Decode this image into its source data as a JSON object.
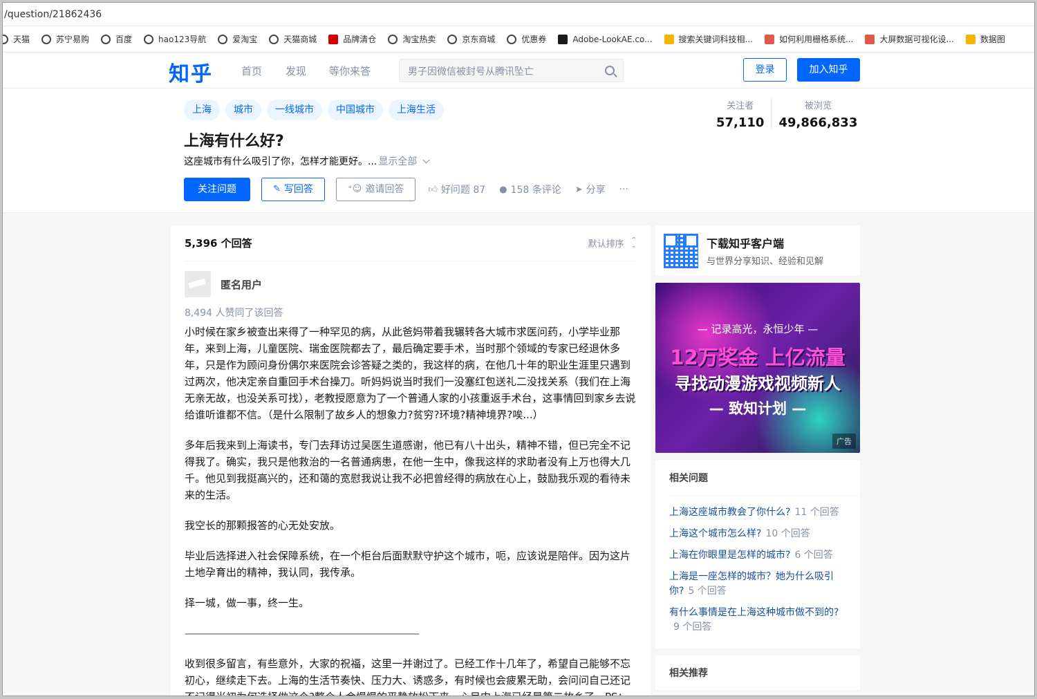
{
  "browser": {
    "url": "/question/21862436",
    "bookmarks": [
      {
        "label": "天猫",
        "icon": "globe-icon",
        "color": "#444444"
      },
      {
        "label": "苏宁易购",
        "icon": "globe-icon",
        "color": "#444444"
      },
      {
        "label": "百度",
        "icon": "globe-icon",
        "color": "#444444"
      },
      {
        "label": "hao123导航",
        "icon": "globe-icon",
        "color": "#444444"
      },
      {
        "label": "爱淘宝",
        "icon": "globe-icon",
        "color": "#444444"
      },
      {
        "label": "天猫商城",
        "icon": "globe-icon",
        "color": "#444444"
      },
      {
        "label": "品牌清仓",
        "icon": "tmall-icon",
        "color": "#d00000"
      },
      {
        "label": "淘宝热卖",
        "icon": "globe-icon",
        "color": "#444444"
      },
      {
        "label": "京东商城",
        "icon": "globe-icon",
        "color": "#444444"
      },
      {
        "label": "优惠券",
        "icon": "globe-icon",
        "color": "#444444"
      },
      {
        "label": "Adobe-LookAE.co...",
        "icon": "dz-icon",
        "color": "#1a1a1a"
      },
      {
        "label": "搜索关键词科技相...",
        "icon": "thumb-icon",
        "color": "#f5b400"
      },
      {
        "label": "如何利用栅格系统...",
        "icon": "jian-icon",
        "color": "#e05a4b"
      },
      {
        "label": "大屏数据可视化设...",
        "icon": "jian-icon",
        "color": "#e05a4b"
      },
      {
        "label": "数据图",
        "icon": "chart-icon",
        "color": "#f5b400"
      }
    ]
  },
  "nav": {
    "logo": "知乎",
    "links": [
      "首页",
      "发现",
      "等你来答"
    ],
    "search_placeholder": "男子因微信被封号从腾讯坠亡",
    "login": "登录",
    "join": "加入知乎"
  },
  "question": {
    "tags": [
      "上海",
      "城市",
      "一线城市",
      "中国城市",
      "上海生活"
    ],
    "title": "上海有什么好?",
    "description": "这座城市有什么吸引了你，怎样才能更好。...",
    "show_all": "显示全部",
    "stats": {
      "followers_label": "关注者",
      "followers": "57,110",
      "views_label": "被浏览",
      "views": "49,866,833"
    },
    "actions": {
      "follow": "关注问题",
      "write": "写回答",
      "invite": "邀请回答",
      "good": "好问题 87",
      "comments": "158 条评论",
      "share": "分享",
      "more": "···"
    }
  },
  "answers": {
    "count": "5,396 个回答",
    "sort": "默认排序",
    "first": {
      "author": "匿名用户",
      "votes": "8,494 人赞同了该回答",
      "paragraphs": [
        "小时候在家乡被查出来得了一种罕见的病，从此爸妈带着我辗转各大城市求医问药，小学毕业那年，来到上海，儿童医院、瑞金医院都去了，最后确定要手术，当时那个领域的专家已经退休多年，只是作为顾问身份偶尔来医院会诊答疑之类的，我这样的病，在他几十年的职业生涯里只遇到过两次，他决定亲自重回手术台操刀。听妈妈说当时我们一没塞红包送礼二没找关系（我们在上海无亲无故，也没关系可找），老教授愿意为了一个普通人家的小孩重返手术台，这事情回到家乡去说给谁听谁都不信。（是什么限制了故乡人的想象力?贫穷?环境?精神境界?唉...）",
        "多年后我来到上海读书，专门去拜访过吴医生道感谢，他已有八十出头，精神不错，但已完全不记得我了。确实，我只是他救治的一名普通病患，在他一生中，像我这样的求助者没有上万也得大几千。他见到我挺高兴的，还和蔼的宽慰我说让我不必把曾经得的病放在心上，鼓励我乐观的看待未来的生活。",
        "我空长的那颗报答的心无处安放。",
        "毕业后选择进入社会保障系统，在一个柜台后面默默守护这个城市，呃，应该说是陪伴。因为这片土地孕育出的精神，我认同，我传承。",
        "择一城，做一事，终一生。",
        "——————————————————————————",
        "收到很多留言，有些意外，大家的祝福，这里一并谢过了。已经工作十几年了，希望自己能够不忘初心，继续走下去。上海的生活节奏快、压力大、诱惑多，有时候也会疲累无助，会问问自己还记不记得当初为何选择做这个?整个人会慢慢的平静放松下来。心目中上海已经是第二故乡了。PS："
      ]
    }
  },
  "sidebar": {
    "download_title": "下载知乎客户端",
    "download_sub": "与世界分享知识、经验和见解",
    "ad": {
      "line1": "— 记录高光，永恒少年 —",
      "line2": "12万奖金 上亿流量",
      "line3": "寻找动漫游戏视频新人",
      "line4": "— 致知计划 —",
      "badge": "广告"
    },
    "related_title": "相关问题",
    "related": [
      {
        "q": "上海这座城市教会了你什么?",
        "count": "11 个回答"
      },
      {
        "q": "上海这个城市怎么样?",
        "count": "10 个回答"
      },
      {
        "q": "上海在你眼里是怎样的城市?",
        "count": "6 个回答"
      },
      {
        "q": "上海是一座怎样的城市？她为什么吸引你?",
        "count": "5 个回答"
      },
      {
        "q": "有什么事情是在上海这种城市做不到的?",
        "count": "9 个回答"
      }
    ],
    "recommend_title": "相关推荐"
  }
}
